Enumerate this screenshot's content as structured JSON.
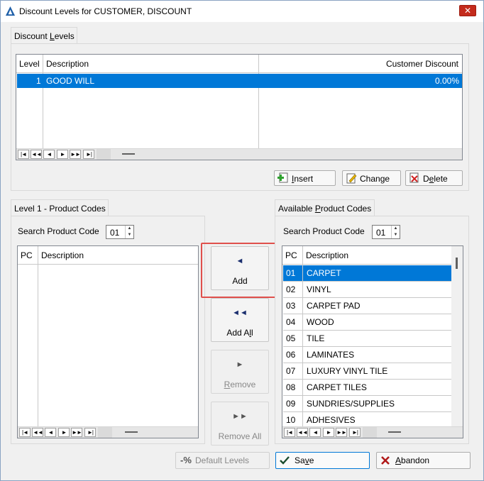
{
  "window": {
    "title": "Discount Levels for CUSTOMER, DISCOUNT",
    "close_glyph": "✕"
  },
  "discount_levels": {
    "tab_label_pre": "Discount ",
    "tab_label_u": "L",
    "tab_label_post": "evels",
    "columns": [
      "Level",
      "Description",
      "Customer Discount"
    ],
    "rows": [
      {
        "level": "1",
        "description": "GOOD WILL",
        "discount": "0.00%"
      }
    ],
    "insert_label_u": "I",
    "insert_label_rest": "nsert",
    "change_label_pre": "Chan",
    "change_label_u": "g",
    "change_label_post": "e",
    "delete_label_pre": "D",
    "delete_label_u": "e",
    "delete_label_post": "lete"
  },
  "level_codes": {
    "tab_label": "Level 1 - Product Codes",
    "search_label": "Search Product Code",
    "search_value": "01",
    "columns": [
      "PC",
      "Description"
    ]
  },
  "available_codes": {
    "tab_label_pre": "Available ",
    "tab_label_u": "P",
    "tab_label_post": "roduct Codes",
    "search_label": "Search Product Code",
    "search_value": "01",
    "columns": [
      "PC",
      "Description"
    ],
    "rows": [
      {
        "pc": "01",
        "description": "CARPET"
      },
      {
        "pc": "02",
        "description": "VINYL"
      },
      {
        "pc": "03",
        "description": "CARPET PAD"
      },
      {
        "pc": "04",
        "description": "WOOD"
      },
      {
        "pc": "05",
        "description": "TILE"
      },
      {
        "pc": "06",
        "description": "LAMINATES"
      },
      {
        "pc": "07",
        "description": "LUXURY VINYL TILE"
      },
      {
        "pc": "08",
        "description": "CARPET TILES"
      },
      {
        "pc": "09",
        "description": "SUNDRIES/SUPPLIES"
      },
      {
        "pc": "10",
        "description": "ADHESIVES"
      }
    ]
  },
  "transfer": {
    "add": "Add",
    "add_arrow": "◄",
    "add_all_pre": "Add A",
    "add_all_u": "l",
    "add_all_post": "l",
    "add_all_arrow": "◄◄",
    "remove_u": "R",
    "remove_post": "emove",
    "remove_arrow": "►",
    "remove_all": "Remove All",
    "remove_all_arrow": "►►"
  },
  "nav": {
    "first": "|◄",
    "prev_page": "◄◄",
    "prev": "◄",
    "next": "►",
    "next_page": "►►",
    "last": "►|"
  },
  "footer": {
    "default_levels": "Default Levels",
    "save_pre": "Sa",
    "save_u": "v",
    "save_post": "e",
    "abandon_u": "A",
    "abandon_post": "bandon"
  },
  "colors": {
    "selection": "#0078d7",
    "highlight_box": "#e0504c"
  }
}
